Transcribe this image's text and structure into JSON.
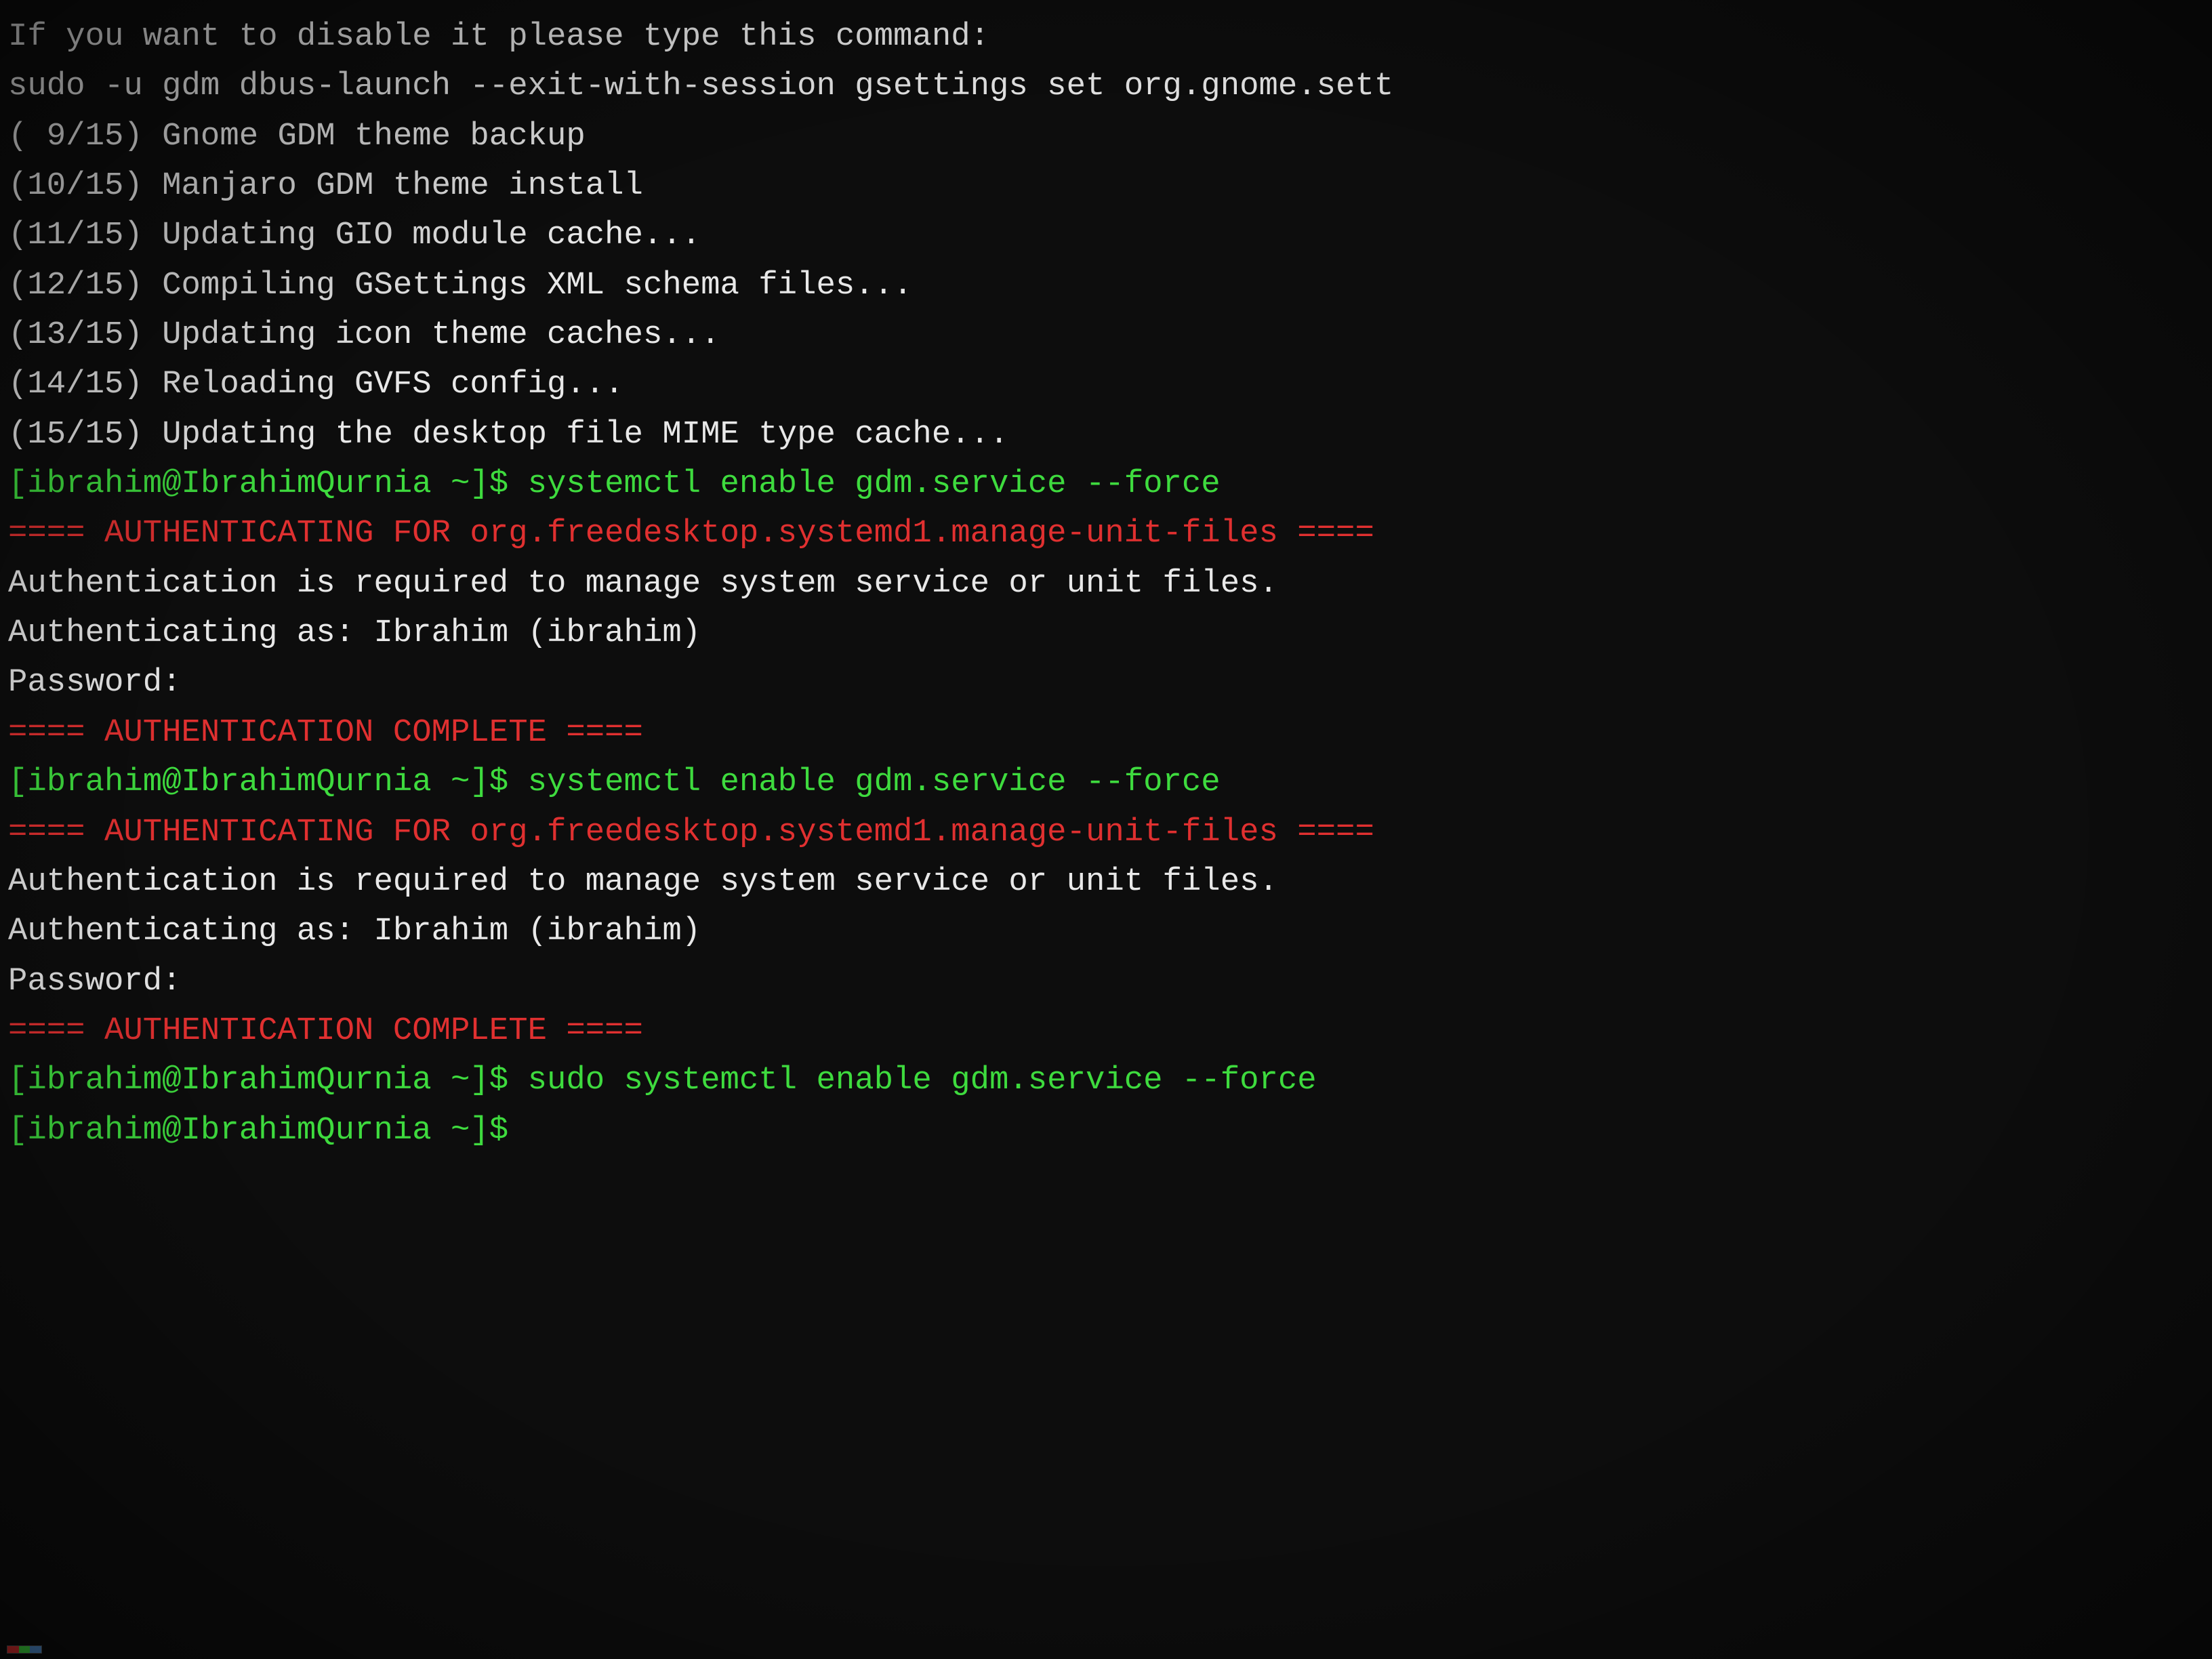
{
  "terminal": {
    "lines": [
      {
        "id": "line1",
        "color": "white",
        "text": "If you want to disable it please type this command:"
      },
      {
        "id": "line2",
        "color": "white",
        "text": ""
      },
      {
        "id": "line3",
        "color": "white",
        "text": "sudo -u gdm dbus-launch --exit-with-session gsettings set org.gnome.sett"
      },
      {
        "id": "line4",
        "color": "white",
        "text": ""
      },
      {
        "id": "line5",
        "color": "white",
        "text": "( 9/15) Gnome GDM theme backup"
      },
      {
        "id": "line6",
        "color": "white",
        "text": "(10/15) Manjaro GDM theme install"
      },
      {
        "id": "line7",
        "color": "white",
        "text": "(11/15) Updating GIO module cache..."
      },
      {
        "id": "line8",
        "color": "white",
        "text": "(12/15) Compiling GSettings XML schema files..."
      },
      {
        "id": "line9",
        "color": "white",
        "text": "(13/15) Updating icon theme caches..."
      },
      {
        "id": "line10",
        "color": "white",
        "text": "(14/15) Reloading GVFS config..."
      },
      {
        "id": "line11",
        "color": "white",
        "text": "(15/15) Updating the desktop file MIME type cache..."
      },
      {
        "id": "line12",
        "color": "green",
        "text": "[ibrahim@IbrahimQurnia ~]$ systemctl enable gdm.service --force"
      },
      {
        "id": "line13",
        "color": "red",
        "text": "==== AUTHENTICATING FOR org.freedesktop.systemd1.manage-unit-files ===="
      },
      {
        "id": "line14",
        "color": "white",
        "text": "Authentication is required to manage system service or unit files."
      },
      {
        "id": "line15",
        "color": "white",
        "text": "Authenticating as: Ibrahim (ibrahim)"
      },
      {
        "id": "line16",
        "color": "white",
        "text": "Password:"
      },
      {
        "id": "line17",
        "color": "red",
        "text": "==== AUTHENTICATION COMPLETE ===="
      },
      {
        "id": "line18",
        "color": "green",
        "text": "[ibrahim@IbrahimQurnia ~]$ systemctl enable gdm.service --force"
      },
      {
        "id": "line19",
        "color": "red",
        "text": "==== AUTHENTICATING FOR org.freedesktop.systemd1.manage-unit-files ===="
      },
      {
        "id": "line20",
        "color": "white",
        "text": "Authentication is required to manage system service or unit files."
      },
      {
        "id": "line21",
        "color": "white",
        "text": "Authenticating as: Ibrahim (ibrahim)"
      },
      {
        "id": "line22",
        "color": "white",
        "text": "Password:"
      },
      {
        "id": "line23",
        "color": "red",
        "text": "==== AUTHENTICATION COMPLETE ===="
      },
      {
        "id": "line24",
        "color": "green",
        "text": "[ibrahim@IbrahimQurnia ~]$ sudo systemctl enable gdm.service --force"
      },
      {
        "id": "line25",
        "color": "green",
        "text": "[ibrahim@IbrahimQurnia ~]$ "
      }
    ],
    "color_bar": {
      "segments": [
        "#e03030",
        "#3edb3e",
        "#4e8cce"
      ]
    }
  }
}
